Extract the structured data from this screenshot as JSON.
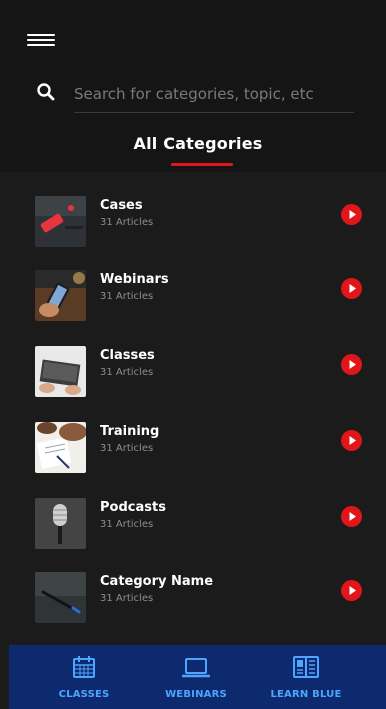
{
  "header": {
    "menu_icon": "hamburger-menu-icon",
    "search_icon": "search-icon",
    "search_placeholder": "Search for categories, topic, etc",
    "title": "All Categories"
  },
  "colors": {
    "background": "#1b1b1b",
    "header_background": "#151515",
    "accent": "#e0161b",
    "nav_background": "#0d2a6e",
    "nav_text": "#4ea4ff",
    "subtitle_text": "#8e8e8e"
  },
  "categories": [
    {
      "title": "Cases",
      "subtitle": "31 Articles",
      "thumb": "cases-thumbnail"
    },
    {
      "title": "Webinars",
      "subtitle": "31 Articles",
      "thumb": "webinars-thumbnail"
    },
    {
      "title": "Classes",
      "subtitle": "31 Articles",
      "thumb": "classes-thumbnail"
    },
    {
      "title": "Training",
      "subtitle": "31 Articles",
      "thumb": "training-thumbnail"
    },
    {
      "title": "Podcasts",
      "subtitle": "31 Articles",
      "thumb": "podcasts-thumbnail"
    },
    {
      "title": "Category Name",
      "subtitle": "31 Articles",
      "thumb": "category-name-thumbnail"
    }
  ],
  "bottom_nav": [
    {
      "label": "CLASSES",
      "icon": "calendar-icon"
    },
    {
      "label": "WEBINARS",
      "icon": "laptop-icon"
    },
    {
      "label": "LEARN BLUE",
      "icon": "book-icon"
    }
  ]
}
